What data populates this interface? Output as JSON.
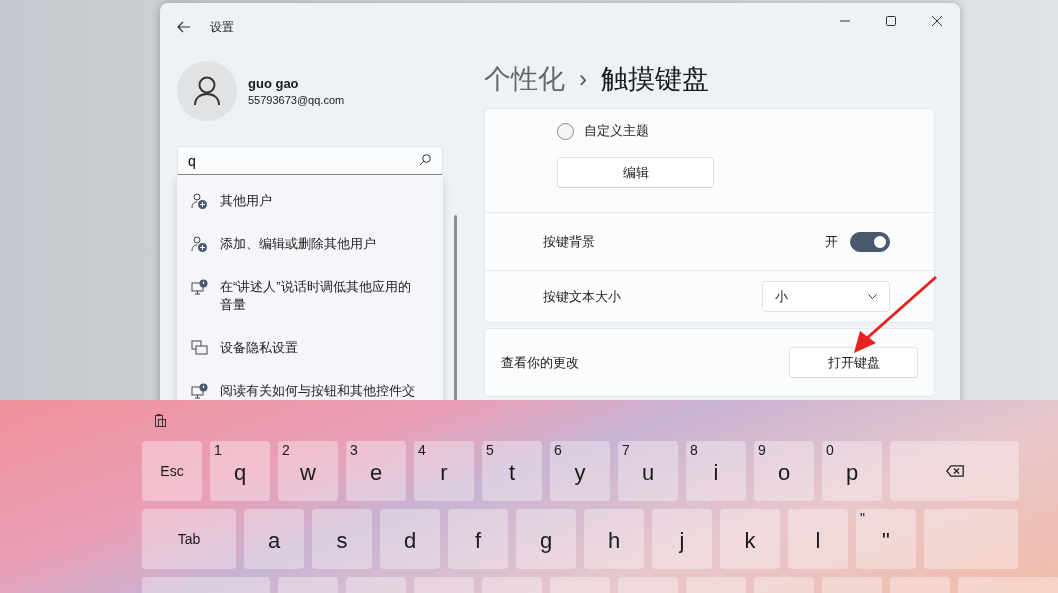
{
  "window": {
    "title": "设置"
  },
  "account": {
    "name": "guo gao",
    "email": "55793673@qq.com"
  },
  "search": {
    "value": "q",
    "results": [
      {
        "kind": "user",
        "label": "其他用户"
      },
      {
        "kind": "user",
        "label": "添加、编辑或删除其他用户"
      },
      {
        "kind": "monitor",
        "label": "在“讲述人”说话时调低其他应用的音量"
      },
      {
        "kind": "devices",
        "label": "设备隐私设置"
      },
      {
        "kind": "monitor",
        "label": "阅读有关如何与按钮和其他控件交"
      }
    ]
  },
  "breadcrumb": {
    "parent": "个性化",
    "separator": "›",
    "current": "触摸键盘"
  },
  "theme": {
    "option": {
      "label": "自定义主题",
      "selected": false
    },
    "button": "编辑"
  },
  "rows": [
    {
      "kind": "toggle",
      "label": "按键背景",
      "state_text": "开",
      "on": true
    },
    {
      "kind": "dropdown",
      "label": "按键文本大小",
      "value": "小"
    }
  ],
  "preview": {
    "label": "查看你的更改",
    "button": "打开键盘"
  },
  "keyboard": {
    "rows": [
      [
        {
          "kind": "text",
          "label": "Esc"
        },
        {
          "kind": "letter",
          "label": "q",
          "hint": "1"
        },
        {
          "kind": "letter",
          "label": "w",
          "hint": "2"
        },
        {
          "kind": "letter",
          "label": "e",
          "hint": "3"
        },
        {
          "kind": "letter",
          "label": "r",
          "hint": "4"
        },
        {
          "kind": "letter",
          "label": "t",
          "hint": "5"
        },
        {
          "kind": "letter",
          "label": "y",
          "hint": "6"
        },
        {
          "kind": "letter",
          "label": "u",
          "hint": "7"
        },
        {
          "kind": "letter",
          "label": "i",
          "hint": "8"
        },
        {
          "kind": "letter",
          "label": "o",
          "hint": "9"
        },
        {
          "kind": "letter",
          "label": "p",
          "hint": "0"
        },
        {
          "kind": "backspace"
        }
      ],
      [
        {
          "kind": "text",
          "label": "Tab",
          "wide": true
        },
        {
          "kind": "letter",
          "label": "a"
        },
        {
          "kind": "letter",
          "label": "s"
        },
        {
          "kind": "letter",
          "label": "d"
        },
        {
          "kind": "letter",
          "label": "f"
        },
        {
          "kind": "letter",
          "label": "g"
        },
        {
          "kind": "letter",
          "label": "h"
        },
        {
          "kind": "letter",
          "label": "j"
        },
        {
          "kind": "letter",
          "label": "k"
        },
        {
          "kind": "letter",
          "label": "l"
        },
        {
          "kind": "letter",
          "label": "\"",
          "hint": "\""
        },
        {
          "kind": "blank",
          "wide": true
        }
      ]
    ]
  }
}
